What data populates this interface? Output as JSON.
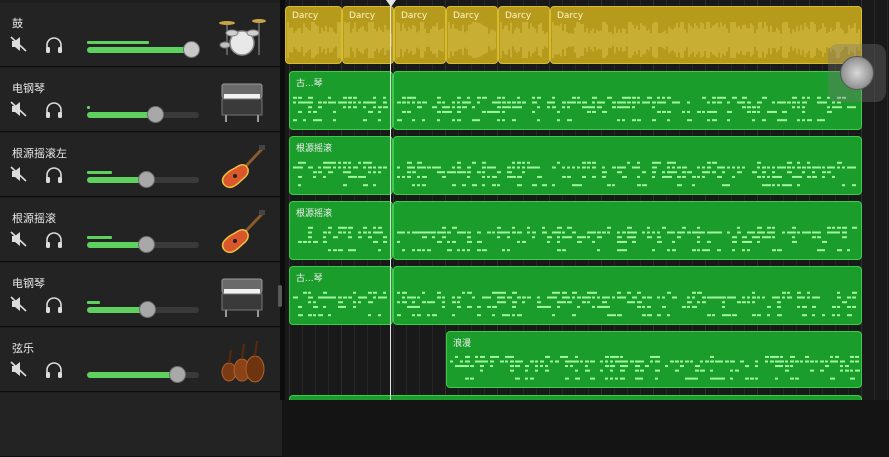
{
  "tracks": [
    {
      "name": "鼓",
      "instrument": "drum-kit-icon",
      "volume": 0.93,
      "meter": 0.55,
      "muted": false
    },
    {
      "name": "电钢琴",
      "instrument": "electric-piano-icon",
      "volume": 0.61,
      "meter": 0.03,
      "muted": false
    },
    {
      "name": "根源摇滚左",
      "instrument": "electric-guitar-icon",
      "volume": 0.53,
      "meter": 0.22,
      "muted": false
    },
    {
      "name": "根源摇滚",
      "instrument": "electric-guitar-icon",
      "volume": 0.53,
      "meter": 0.22,
      "muted": false
    },
    {
      "name": "电钢琴",
      "instrument": "electric-piano-icon",
      "volume": 0.54,
      "meter": 0.12,
      "muted": false
    },
    {
      "name": "弦乐",
      "instrument": "strings-icon",
      "volume": 0.8,
      "meter": 0.0,
      "muted": false
    }
  ],
  "regions": {
    "drums": [
      "Darcy",
      "Darcy",
      "Darcy",
      "Darcy",
      "Darcy",
      "Darcy"
    ],
    "piano1": "古...琴",
    "rock_left": "根源摇滚",
    "rock": "根源摇滚",
    "piano2": "古...琴",
    "strings": "浪漫"
  },
  "colors": {
    "drum_region": "#b59a1c",
    "midi_region": "#1b9d2b",
    "volume_fill": "#5ed15e",
    "playhead": "#e6e6e6"
  }
}
